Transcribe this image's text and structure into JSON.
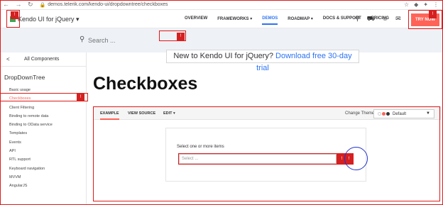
{
  "browser": {
    "url": "demos.telerik.com/kendo-ui/dropdowntree/checkboxes"
  },
  "topnav": {
    "brand": "Kendo UI for jQuery",
    "menu": [
      {
        "label": "OVERVIEW"
      },
      {
        "label": "FRAMEWORKS ▾"
      },
      {
        "label": "DEMOS"
      },
      {
        "label": "ROADMAP ▾"
      },
      {
        "label": "DOCS & SUPPORT"
      },
      {
        "label": "PRICING"
      }
    ],
    "try_button": "TRY NOW"
  },
  "search": {
    "placeholder": "Search ..."
  },
  "banner": {
    "text": "New to Kendo UI for jQuery?",
    "link": "Download free 30-day trial"
  },
  "sidebar": {
    "back_label": "All Components",
    "category": "DropDownTree",
    "items": [
      {
        "label": "Basic usage"
      },
      {
        "label": "Checkboxes"
      },
      {
        "label": "Client Filtering"
      },
      {
        "label": "Binding to remote data"
      },
      {
        "label": "Binding to OData service"
      },
      {
        "label": "Templates"
      },
      {
        "label": "Events"
      },
      {
        "label": "API"
      },
      {
        "label": "RTL support"
      },
      {
        "label": "Keyboard navigation"
      },
      {
        "label": "MVVM"
      },
      {
        "label": "AngularJS"
      }
    ]
  },
  "main": {
    "title": "Checkboxes",
    "tabs": [
      {
        "label": "EXAMPLE"
      },
      {
        "label": "VIEW SOURCE"
      },
      {
        "label": "EDIT ▾"
      }
    ],
    "theme_label": "Change Theme",
    "theme_value": "Default",
    "demo_label": "Select one or more items",
    "dropdown_placeholder": "Select ..."
  },
  "annotations": {
    "badge_text": "!"
  },
  "colors": {
    "accent": "#2d73f5",
    "kendo_red": "#ff6358",
    "annotation_red": "#d42020"
  }
}
